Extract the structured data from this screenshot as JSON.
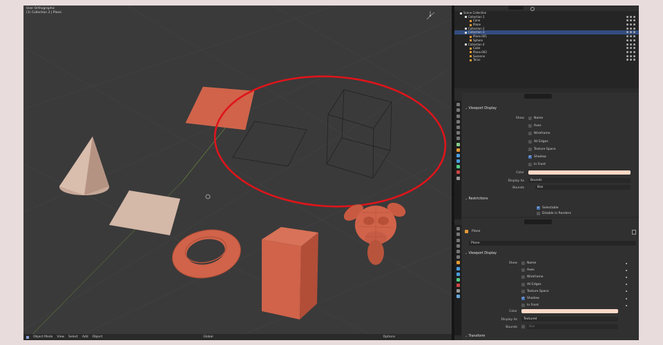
{
  "viewport": {
    "title_line1": "User Orthographic",
    "title_line2": "(1) Collection 3 | Plane",
    "bottom": {
      "mode": "Object Mode",
      "view": "View",
      "select": "Select",
      "add": "Add",
      "object": "Object",
      "transform": "Global",
      "options": "Options"
    }
  },
  "outliner": {
    "rows": [
      {
        "label": "Scene Collection",
        "indent": 0,
        "icon": "collection",
        "selected": false
      },
      {
        "label": "Collection 1",
        "indent": 1,
        "icon": "collection",
        "selected": false
      },
      {
        "label": "Cone",
        "indent": 2,
        "icon": "object",
        "selected": false
      },
      {
        "label": "Plane",
        "indent": 2,
        "icon": "object",
        "selected": false
      },
      {
        "label": "Collection 2",
        "indent": 1,
        "icon": "collection",
        "selected": false
      },
      {
        "label": "Collection 3",
        "indent": 1,
        "icon": "collection",
        "selected": true
      },
      {
        "label": "Plane.001",
        "indent": 2,
        "icon": "object",
        "selected": false
      },
      {
        "label": "Sphere",
        "indent": 2,
        "icon": "object",
        "selected": false
      },
      {
        "label": "Collection 4",
        "indent": 1,
        "icon": "collection",
        "selected": false
      },
      {
        "label": "Cube",
        "indent": 2,
        "icon": "object",
        "selected": false
      },
      {
        "label": "Plane.002",
        "indent": 2,
        "icon": "object",
        "selected": false
      },
      {
        "label": "Suzanne",
        "indent": 2,
        "icon": "object",
        "selected": false
      },
      {
        "label": "Torus",
        "indent": 2,
        "icon": "object",
        "selected": false
      }
    ]
  },
  "panel1": {
    "section": "Viewport Display",
    "show_label": "Show",
    "options": [
      {
        "label": "Name",
        "checked": false
      },
      {
        "label": "Axes",
        "checked": false
      },
      {
        "label": "Wireframe",
        "checked": false
      },
      {
        "label": "All Edges",
        "checked": false
      },
      {
        "label": "Texture Space",
        "checked": false
      },
      {
        "label": "Shadow",
        "checked": true
      },
      {
        "label": "In Front",
        "checked": false
      }
    ],
    "color_label": "Color",
    "display_as_label": "Display As",
    "display_as_value": "Bounds",
    "bounds_label": "Bounds",
    "bounds_value": "Box",
    "restrictions": "Restrictions",
    "selectable": "Selectable",
    "disable_renders": "Disable in Renders"
  },
  "panel2": {
    "object_name": "Plane",
    "object_field": "Plane",
    "section": "Viewport Display",
    "show_label": "Show",
    "options": [
      {
        "label": "Name",
        "checked": false
      },
      {
        "label": "Axes",
        "checked": false
      },
      {
        "label": "Wireframe",
        "checked": false
      },
      {
        "label": "All Edges",
        "checked": false
      },
      {
        "label": "Texture Space",
        "checked": false
      },
      {
        "label": "Shadow",
        "checked": true
      },
      {
        "label": "In Front",
        "checked": false
      }
    ],
    "color_label": "Color",
    "display_as_label": "Display As",
    "display_as_value": "Textured",
    "bounds_label": "Bounds",
    "bounds_value": "Box",
    "transform": "Transform"
  },
  "colors": {
    "object": "#d0634a",
    "object_light": "#d4b8a8",
    "annotation": "#e0141a",
    "selection": "#334d80",
    "checkbox_on": "#4772b3",
    "swatch": "#ffd9c7"
  }
}
